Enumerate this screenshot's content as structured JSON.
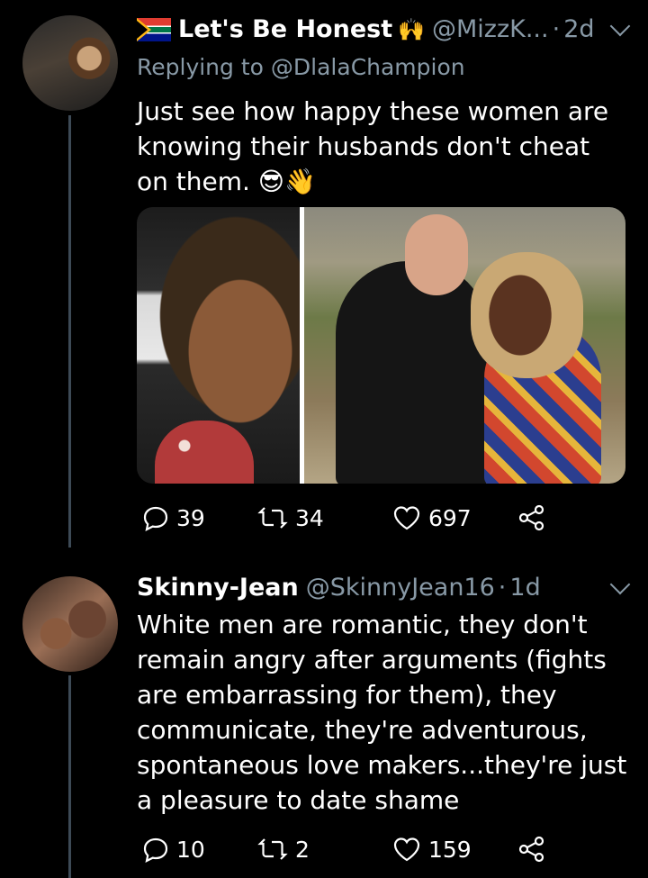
{
  "tweets": [
    {
      "name": "Let's Be Honest",
      "handle": "@MizzK...",
      "time": "2d",
      "replying_label": "Replying to",
      "replying_to": "@DlalaChampion",
      "text": "Just see how happy these women are knowing their husbands don't cheat on them. 😎👋",
      "replies": "39",
      "retweets": "34",
      "likes": "697"
    },
    {
      "name": "Skinny-Jean",
      "handle": "@SkinnyJean16",
      "time": "1d",
      "text": "White men are romantic, they don't remain angry after arguments (fights are embarrassing for them), they communicate, they're adventurous, spontaneous love makers...they're just a pleasure to date shame",
      "replies": "10",
      "retweets": "2",
      "likes": "159"
    }
  ],
  "icons": {
    "flag": "south-africa-flag-icon",
    "hands": "raised-hands-icon",
    "reply": "reply-icon",
    "retweet": "retweet-icon",
    "like": "heart-icon",
    "share": "share-icon",
    "more": "chevron-down-icon"
  },
  "colors": {
    "background": "#000000",
    "text": "#ffffff",
    "secondary": "#8899a6",
    "thread_line": "#3d4a56"
  }
}
